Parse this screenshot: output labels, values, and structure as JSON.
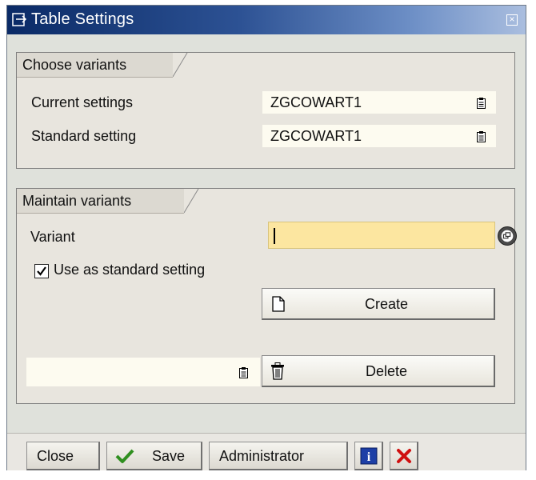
{
  "window": {
    "title": "Table Settings"
  },
  "choose_variants": {
    "group_title": "Choose variants",
    "rows": [
      {
        "label": "Current settings",
        "value": "ZGCOWART1"
      },
      {
        "label": "Standard setting",
        "value": "ZGCOWART1"
      }
    ]
  },
  "maintain_variants": {
    "group_title": "Maintain variants",
    "variant_label": "Variant",
    "variant_value": "",
    "use_as_standard_label": "Use as standard setting",
    "use_as_standard_checked": true,
    "create_label": "Create",
    "delete_field_value": "",
    "delete_label": "Delete"
  },
  "footer": {
    "close_label": "Close",
    "save_label": "Save",
    "administrator_label": "Administrator"
  },
  "icons": {
    "title": "table-settings-icon",
    "help": "value-help-icon",
    "f4": "possible-entries-icon",
    "create": "new-document-icon",
    "delete": "trash-icon",
    "save": "checkmark-icon",
    "info": "information-icon",
    "cancel": "cancel-icon"
  },
  "colors": {
    "title_bar": "#0a2a66",
    "input_highlight": "#fce6a0",
    "panel": "#e8e5de",
    "save_check": "#2f8f1f",
    "cancel_red": "#d01010"
  }
}
